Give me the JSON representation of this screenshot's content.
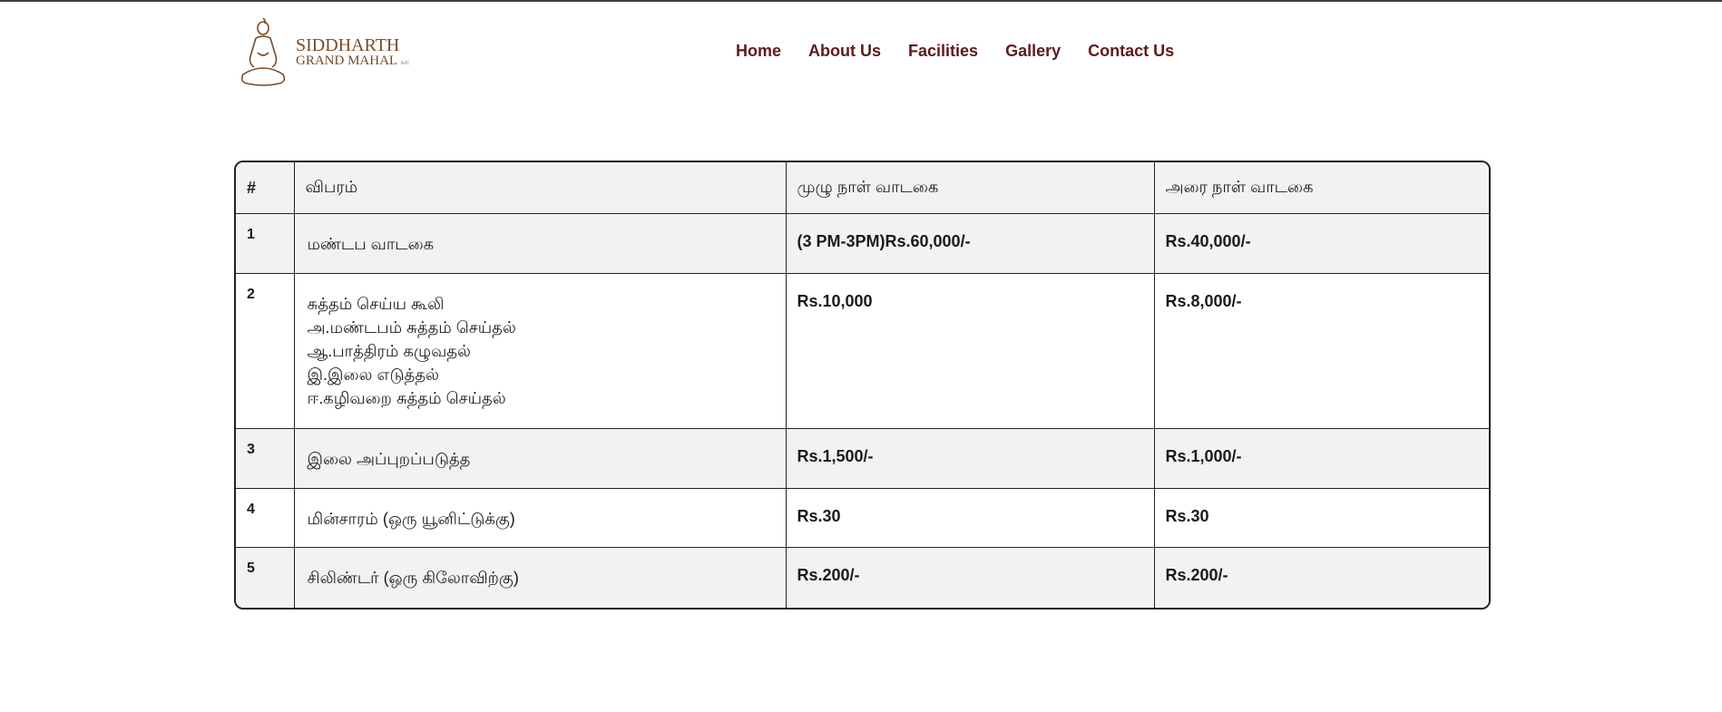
{
  "brand": {
    "line1": "SIDDHARTH",
    "line2": "GRAND MAHAL",
    "suffix": "A/C",
    "icon": "buddha-icon",
    "color": "#7a4a25"
  },
  "nav": {
    "items": [
      {
        "label": "Home"
      },
      {
        "label": "About Us"
      },
      {
        "label": "Facilities"
      },
      {
        "label": "Gallery"
      },
      {
        "label": "Contact Us"
      }
    ],
    "color": "#5e1b1b"
  },
  "table": {
    "headers": [
      "#",
      "விபரம்",
      "முழு நாள் வாடகை",
      "அரை நாள் வாடகை"
    ],
    "rows": [
      {
        "num": "1",
        "desc": [
          "மண்டப வாடகை"
        ],
        "full": "(3 PM-3PM)Rs.60,000/-",
        "half": "Rs.40,000/-"
      },
      {
        "num": "2",
        "desc": [
          "சுத்தம் செய்ய கூலி",
          "அ.மண்டபம் சுத்தம் செய்தல்",
          "ஆ.பாத்திரம் கழுவதல்",
          "இ.இலை எடுத்தல்",
          "ஈ.கழிவறை சுத்தம் செய்தல்"
        ],
        "full": "Rs.10,000",
        "half": "Rs.8,000/-"
      },
      {
        "num": "3",
        "desc": [
          "இலை அப்புறப்படுத்த"
        ],
        "full": "Rs.1,500/-",
        "half": "Rs.1,000/-"
      },
      {
        "num": "4",
        "desc": [
          "மின்சாரம் (ஒரு யூனிட்டுக்கு)"
        ],
        "full": "Rs.30",
        "half": "Rs.30"
      },
      {
        "num": "5",
        "desc": [
          "சிலிண்டர் (ஒரு கிலோவிற்கு)"
        ],
        "full": "Rs.200/-",
        "half": "Rs.200/-"
      }
    ]
  }
}
